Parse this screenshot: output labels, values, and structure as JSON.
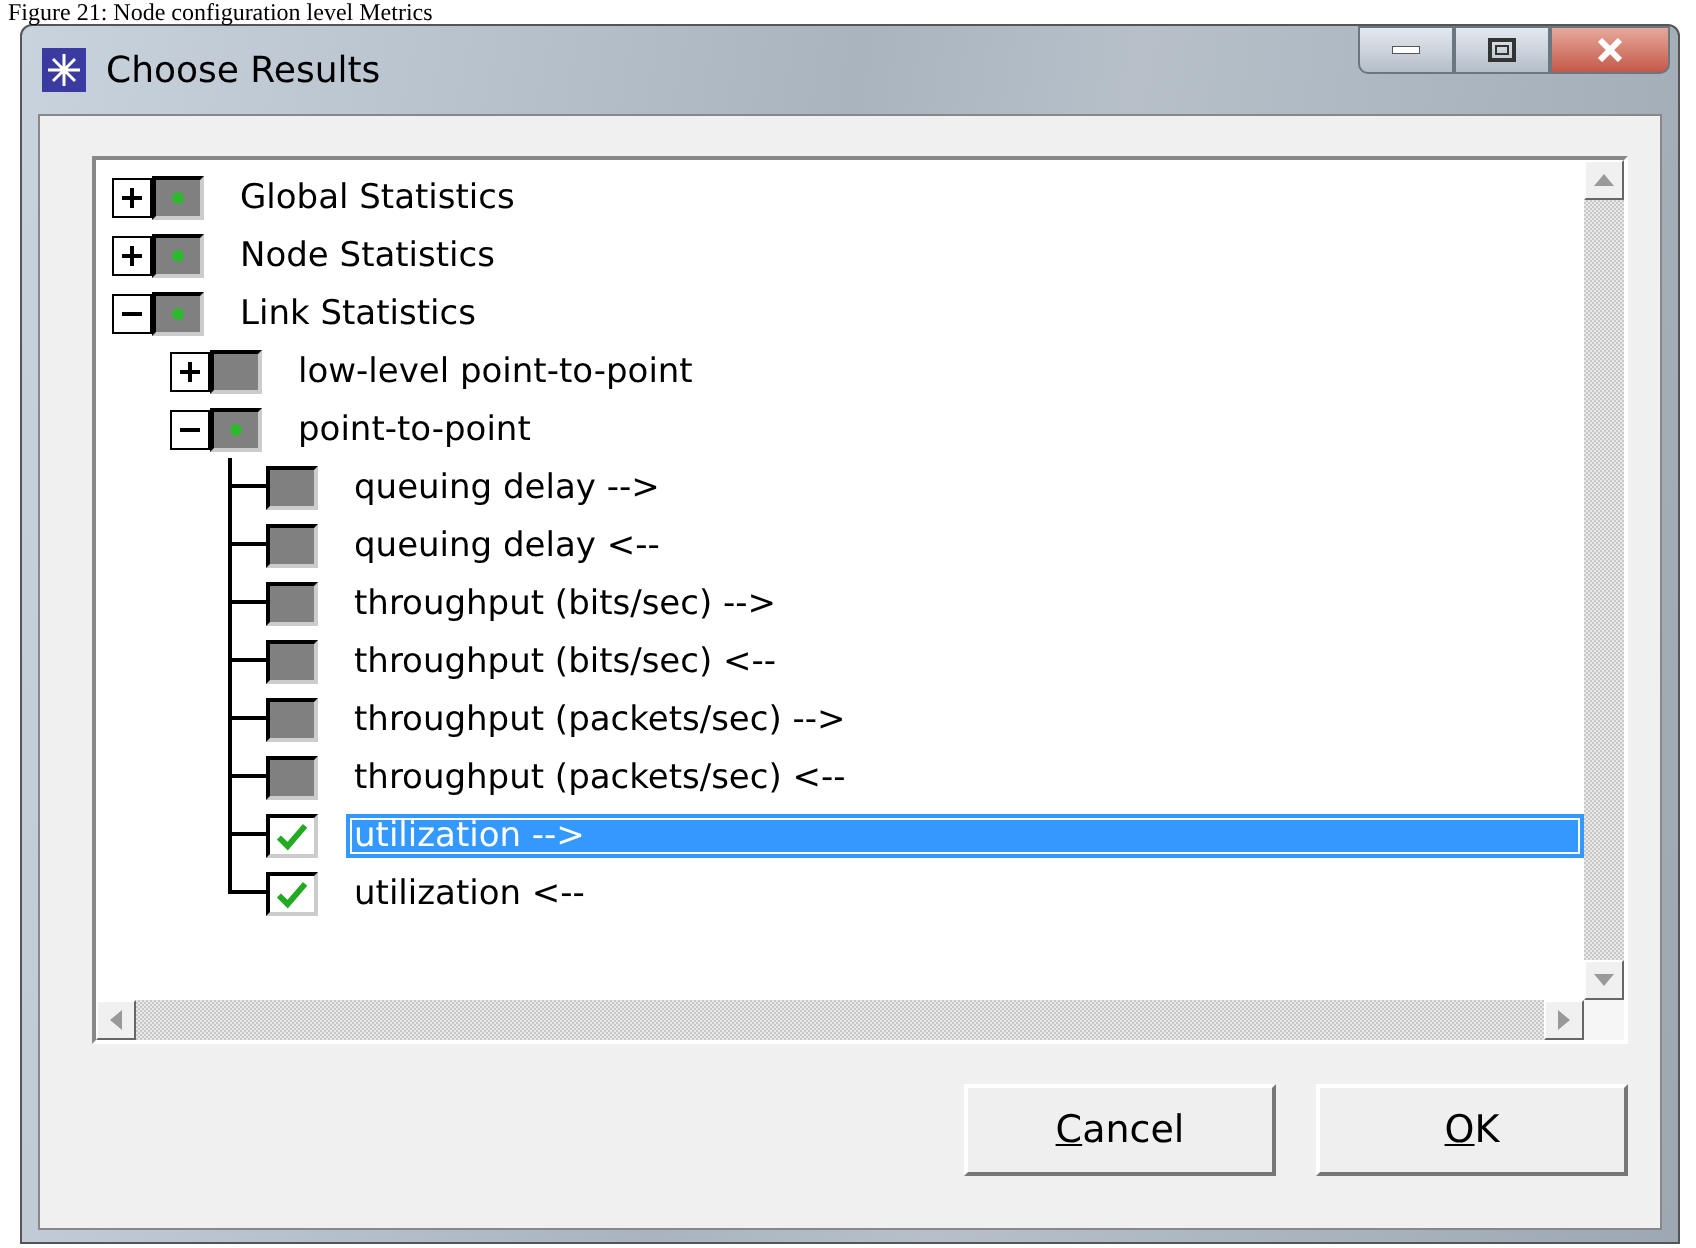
{
  "caption": "Figure 21: Node configuration level Metrics",
  "window": {
    "title": "Choose Results"
  },
  "tree": [
    {
      "label": "Global Statistics",
      "partial": true,
      "expanded": false
    },
    {
      "label": "Node Statistics",
      "partial": true,
      "expanded": false
    },
    {
      "label": "Link Statistics",
      "partial": true,
      "expanded": true,
      "children": [
        {
          "label": "low-level point-to-point",
          "partial": false,
          "expanded": false
        },
        {
          "label": "point-to-point",
          "partial": true,
          "expanded": true,
          "children": [
            {
              "label": "queuing delay -->",
              "checked": false,
              "selected": false
            },
            {
              "label": "queuing delay <--",
              "checked": false,
              "selected": false
            },
            {
              "label": "throughput (bits/sec) -->",
              "checked": false,
              "selected": false
            },
            {
              "label": "throughput (bits/sec) <--",
              "checked": false,
              "selected": false
            },
            {
              "label": "throughput (packets/sec) -->",
              "checked": false,
              "selected": false
            },
            {
              "label": "throughput (packets/sec) <--",
              "checked": false,
              "selected": false
            },
            {
              "label": "utilization -->",
              "checked": true,
              "selected": true
            },
            {
              "label": "utilization <--",
              "checked": true,
              "selected": false
            }
          ]
        }
      ]
    }
  ],
  "buttons": [
    "Cancel",
    "OK"
  ]
}
